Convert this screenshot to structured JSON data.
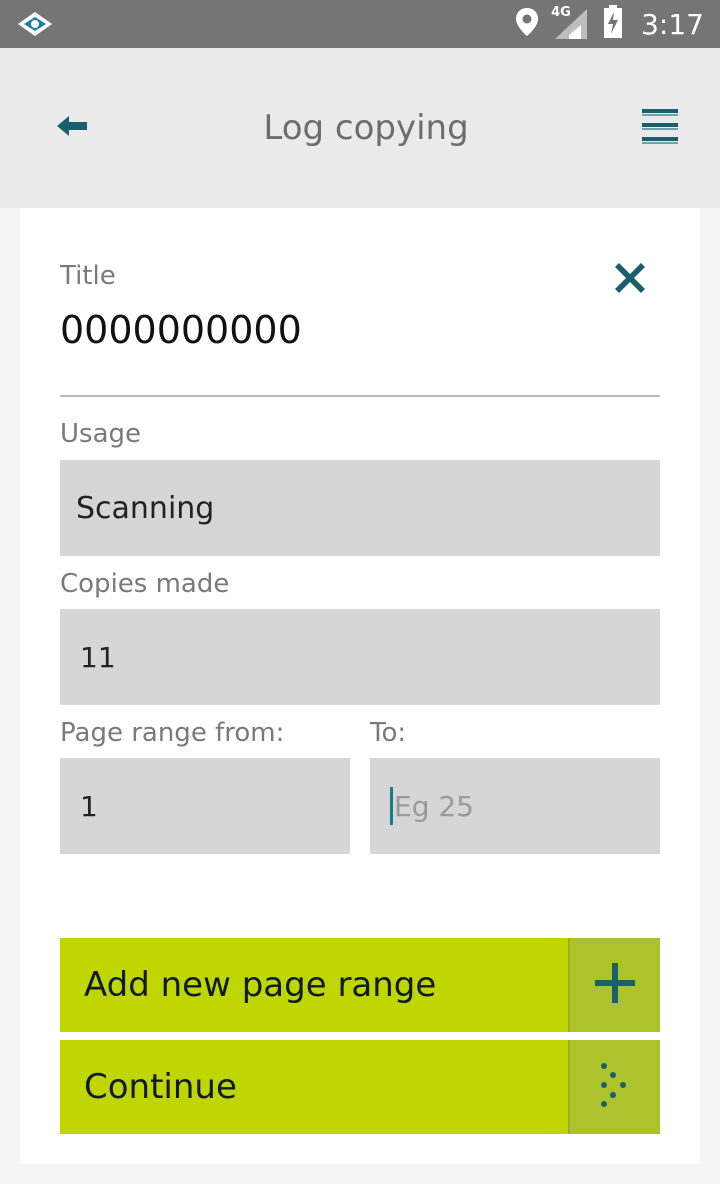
{
  "status_bar": {
    "network_label": "4G",
    "time": "3:17"
  },
  "app_bar": {
    "title": "Log copying",
    "back_icon": "arrow-left-icon",
    "menu_icon": "hamburger-menu-icon"
  },
  "form": {
    "title_label": "Title",
    "title_value": "0000000000",
    "clear_icon": "close-icon",
    "usage_label": "Usage",
    "usage_value": "Scanning",
    "copies_label": "Copies made",
    "copies_value": "11",
    "page_from_label": "Page range from:",
    "page_from_value": "1",
    "page_to_label": "To:",
    "page_to_placeholder": "Eg 25",
    "page_to_value": ""
  },
  "actions": {
    "add_range_label": "Add new page range",
    "add_range_icon": "plus-icon",
    "continue_label": "Continue",
    "continue_icon": "dotted-arrow-right-icon"
  },
  "colors": {
    "accent": "#1a5f6e",
    "button_bg": "#bfd600",
    "button_icon_bg": "#adc32b",
    "field_bg": "#d6d6d6",
    "app_bar_bg": "#ebebeb",
    "status_bar_bg": "#757575"
  }
}
